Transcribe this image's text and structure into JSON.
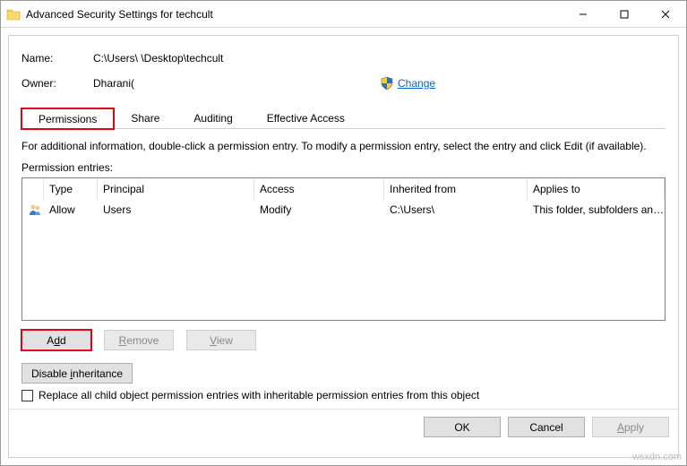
{
  "window": {
    "title": "Advanced Security Settings for techcult"
  },
  "props": {
    "name_label": "Name:",
    "name_value": "C:\\Users\\                              \\Desktop\\techcult",
    "owner_label": "Owner:",
    "owner_value": "Dharani(",
    "change_link": "Change"
  },
  "tabs": {
    "permissions": "Permissions",
    "share": "Share",
    "auditing": "Auditing",
    "effective": "Effective Access",
    "active": "permissions"
  },
  "info_text": "For additional information, double-click a permission entry. To modify a permission entry, select the entry and click Edit (if available).",
  "entries_label": "Permission entries:",
  "columns": {
    "type": "Type",
    "principal": "Principal",
    "access": "Access",
    "inherited": "Inherited from",
    "applies": "Applies to"
  },
  "rows": [
    {
      "type": "Allow",
      "principal": "Users",
      "access": "Modify",
      "inherited": "C:\\Users\\",
      "applies": "This folder, subfolders and files"
    }
  ],
  "buttons": {
    "add": "Add",
    "remove": "Remove",
    "view": "View",
    "disable_inheritance": "Disable inheritance",
    "ok": "OK",
    "cancel": "Cancel",
    "apply": "Apply"
  },
  "checkbox": {
    "label": "Replace all child object permission entries with inheritable permission entries from this object",
    "checked": false
  },
  "watermark": "wsxdn.com"
}
